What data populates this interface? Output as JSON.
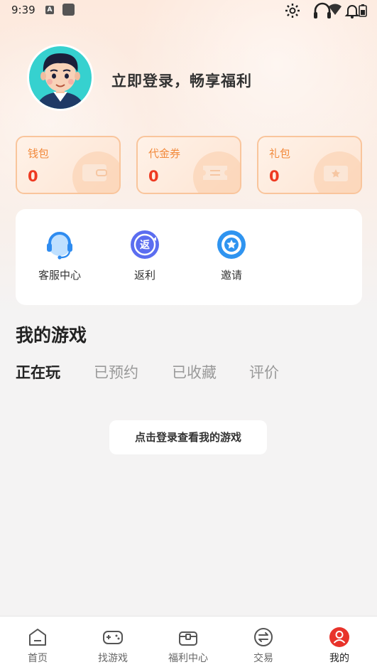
{
  "status_bar": {
    "time": "9:39",
    "a_badge": "A"
  },
  "profile": {
    "login_prompt": "立即登录，畅享福利"
  },
  "assets": [
    {
      "label": "钱包",
      "value": "0"
    },
    {
      "label": "代金券",
      "value": "0"
    },
    {
      "label": "礼包",
      "value": "0"
    }
  ],
  "services": [
    {
      "label": "客服中心",
      "icon": "headset-icon"
    },
    {
      "label": "返利",
      "icon": "rebate-icon"
    },
    {
      "label": "邀请",
      "icon": "invite-icon"
    }
  ],
  "my_games": {
    "title": "我的游戏",
    "tabs": [
      "正在玩",
      "已预约",
      "已收藏",
      "评价"
    ],
    "active_tab": "正在玩",
    "login_button": "点击登录查看我的游戏"
  },
  "bottom_nav": [
    {
      "label": "首页",
      "icon": "home-icon"
    },
    {
      "label": "找游戏",
      "icon": "gamepad-icon"
    },
    {
      "label": "福利中心",
      "icon": "gift-box-icon"
    },
    {
      "label": "交易",
      "icon": "exchange-icon"
    },
    {
      "label": "我的",
      "icon": "user-icon",
      "active": true
    }
  ],
  "colors": {
    "accent_red": "#ee3a22",
    "asset_label": "#f28a3c",
    "asset_border": "#f9c59c",
    "nav_active": "#e8332b"
  }
}
